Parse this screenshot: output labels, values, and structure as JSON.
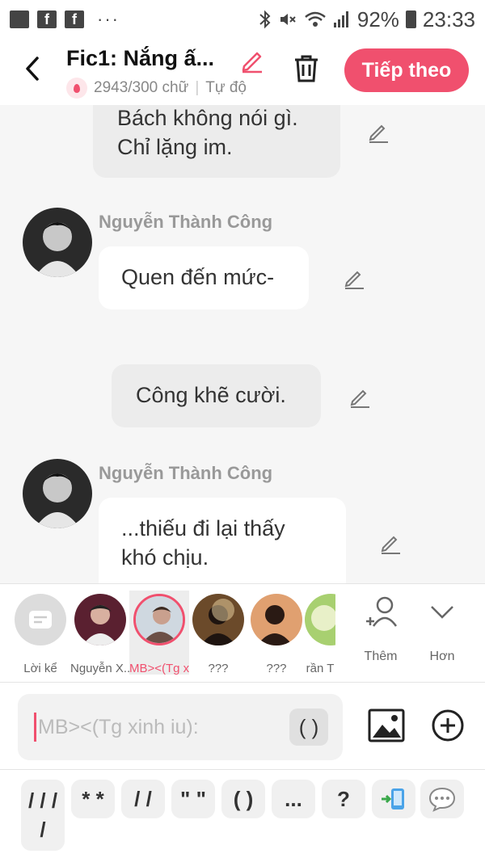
{
  "status_bar": {
    "battery": "92%",
    "time": "23:33"
  },
  "header": {
    "title": "Fic1: Nắng ấ...",
    "word_count": "2943/300 chữ",
    "mode": "Tự độ",
    "next_label": "Tiếp theo"
  },
  "messages": [
    {
      "text_line1": "Bách không nói gì.",
      "text_line2": "Chỉ lặng im."
    },
    {
      "sender": "Nguyễn Thành Công",
      "text": "Quen đến mức-"
    },
    {
      "text": "Công khẽ cười."
    },
    {
      "sender": "Nguyễn Thành Công",
      "text_line1": "...thiếu đi lại thấy",
      "text_line2": "khó chịu."
    }
  ],
  "characters": [
    {
      "label": "Lời kể"
    },
    {
      "label": "Nguyễn X..."
    },
    {
      "label": "MB><(Tg x..."
    },
    {
      "label": "???"
    },
    {
      "label": "???"
    },
    {
      "label": "rần T"
    }
  ],
  "controls": {
    "add_label": "Thêm",
    "more_label": "Hơn"
  },
  "input": {
    "placeholder": "MB><(Tg xinh iu):",
    "paren_label": "( )"
  },
  "symbols": {
    "s1a": "/ / /",
    "s1b": "/",
    "s2": "* *",
    "s3": "/ /",
    "s4": "\" \"",
    "s5": "( )",
    "s6": "...",
    "s7": "?"
  },
  "colors": {
    "accent": "#f0506e",
    "background": "#f6f6f6"
  }
}
